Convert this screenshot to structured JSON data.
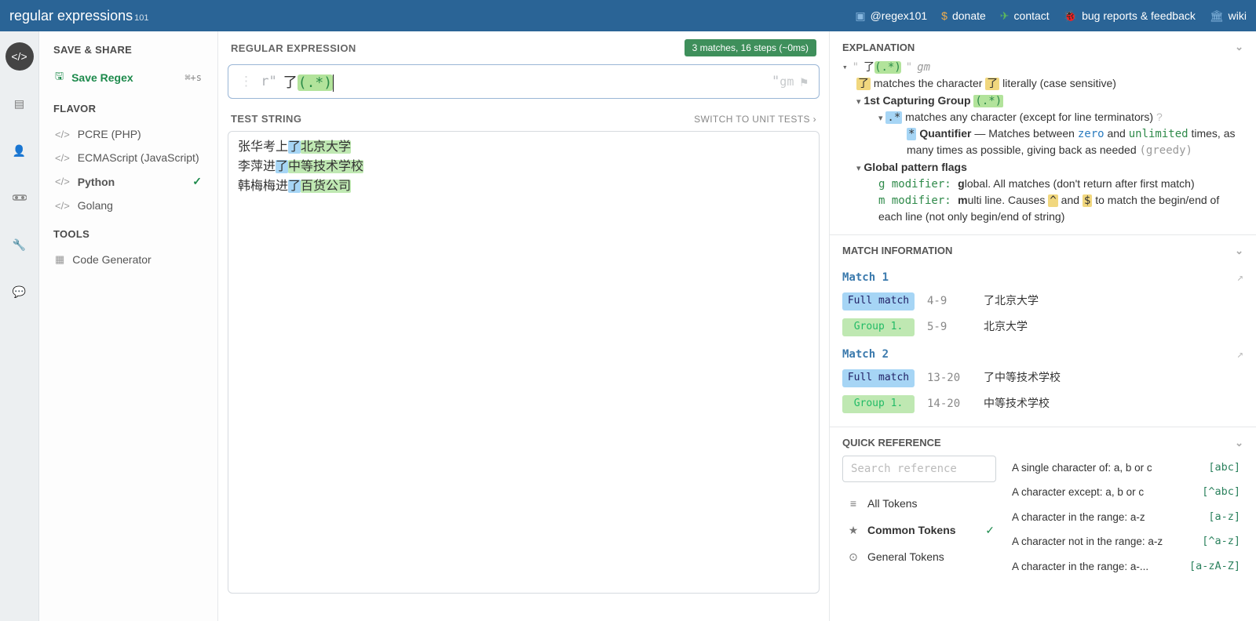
{
  "app": {
    "title_a": "regular",
    "title_b": "expressions",
    "title_c": "101"
  },
  "nav": [
    {
      "label": "@regex101",
      "iconCls": "ic-b",
      "icon": "twitter"
    },
    {
      "label": "donate",
      "iconCls": "ic-y",
      "icon": "dollar"
    },
    {
      "label": "contact",
      "iconCls": "ic-g",
      "icon": "send"
    },
    {
      "label": "bug reports & feedback",
      "iconCls": "ic-r",
      "icon": "bug"
    },
    {
      "label": "wiki",
      "iconCls": "ic-b",
      "icon": "bank"
    }
  ],
  "sidebar": {
    "saveShare": "SAVE & SHARE",
    "saveRegex": "Save Regex",
    "saveKbd": "⌘+s",
    "flavor": "FLAVOR",
    "flavors": [
      {
        "label": "PCRE (PHP)"
      },
      {
        "label": "ECMAScript (JavaScript)"
      },
      {
        "label": "Python",
        "active": true
      },
      {
        "label": "Golang"
      }
    ],
    "tools": "TOOLS",
    "codegen": "Code Generator"
  },
  "editor": {
    "reHeader": "REGULAR EXPRESSION",
    "chip": "3 matches, 16 steps (~0ms)",
    "prefix": "r\"",
    "expr_lit": "了",
    "expr_grp": "(.*)",
    "suffix_q": "\"",
    "flags": "gm",
    "tsHeader": "TEST STRING",
    "switch": "SWITCH TO UNIT TESTS  ›",
    "lines": [
      {
        "pre": "张华考上",
        "le": "了",
        "grp": "北京大学"
      },
      {
        "pre": "李萍进",
        "le": "了",
        "grp": "中等技术学校"
      },
      {
        "pre": "韩梅梅进",
        "le": "了",
        "grp": "百货公司"
      }
    ]
  },
  "explanation": {
    "header": "EXPLANATION",
    "topPat_lit": "了",
    "topPat_grp": "(.*)",
    "topFlags": "gm",
    "l1a": "了",
    "l1b": " matches the character ",
    "l1c": "了",
    "l1d": " literally (case sensitive)",
    "l2": "1st Capturing Group ",
    "l2g": "(.*)",
    "l3a": ".*",
    "l3b": " matches any character (except for line terminators) ",
    "l4a": "*",
    "l4b": " Quantifier",
    "l4c": " — Matches between ",
    "l4d": "zero",
    "l4e": " and ",
    "l4f": "unlimited",
    "l4g": " times, as many times as possible, giving back as needed ",
    "l4h": "(greedy)",
    "gpf": "Global pattern flags",
    "gl": "g modifier: ",
    "glb": "g",
    "glc": "lobal. All matches (don't return after first match)",
    "ml": "m modifier: ",
    "mlb": "m",
    "mlc": "ulti line. Causes ",
    "mld": "^",
    "mle": " and ",
    "mlf": "$",
    "mlg": " to match the begin/end of each line (not only begin/end of string)"
  },
  "matchInfo": {
    "header": "MATCH INFORMATION",
    "matches": [
      {
        "n": "Match 1",
        "rows": [
          {
            "tag": "Full match",
            "cls": "fm",
            "rng": "4-9",
            "txt": "了北京大学"
          },
          {
            "tag": "Group 1.",
            "cls": "g1",
            "rng": "5-9",
            "txt": "北京大学"
          }
        ]
      },
      {
        "n": "Match 2",
        "rows": [
          {
            "tag": "Full match",
            "cls": "fm",
            "rng": "13-20",
            "txt": "了中等技术学校"
          },
          {
            "tag": "Group 1.",
            "cls": "g1",
            "rng": "14-20",
            "txt": "中等技术学校"
          }
        ]
      }
    ]
  },
  "quickref": {
    "header": "QUICK REFERENCE",
    "searchPH": "Search reference",
    "cats": [
      {
        "icon": "≡",
        "label": "All Tokens"
      },
      {
        "icon": "★",
        "label": "Common Tokens",
        "active": true
      },
      {
        "icon": "⊙",
        "label": "General Tokens"
      }
    ],
    "tokens": [
      {
        "desc": "A single character of: a, b or c",
        "code": "[abc]"
      },
      {
        "desc": "A character except: a, b or c",
        "code": "[^abc]"
      },
      {
        "desc": "A character in the range: a-z",
        "code": "[a-z]"
      },
      {
        "desc": "A character not in the range: a-z",
        "code": "[^a-z]"
      },
      {
        "desc": "A character in the range: a-...",
        "code": "[a-zA-Z]"
      }
    ]
  }
}
